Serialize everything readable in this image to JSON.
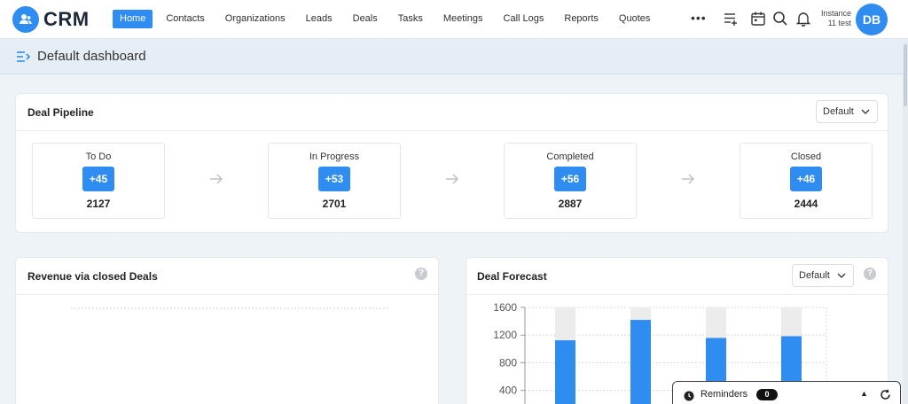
{
  "app": {
    "logo_text": "CRM"
  },
  "nav": {
    "items": [
      "Home",
      "Contacts",
      "Organizations",
      "Leads",
      "Deals",
      "Tasks",
      "Meetings",
      "Call Logs",
      "Reports",
      "Quotes"
    ],
    "active": "Home",
    "more": "•••"
  },
  "user": {
    "line1": "Instance",
    "line2": "11 test",
    "initials": "DB"
  },
  "page": {
    "title": "Default dashboard"
  },
  "pipeline": {
    "title": "Deal Pipeline",
    "dropdown": "Default",
    "stages": [
      {
        "name": "To Do",
        "delta": "+45",
        "count": "2127"
      },
      {
        "name": "In Progress",
        "delta": "+53",
        "count": "2701"
      },
      {
        "name": "Completed",
        "delta": "+56",
        "count": "2887"
      },
      {
        "name": "Closed",
        "delta": "+46",
        "count": "2444"
      }
    ]
  },
  "revenue": {
    "title": "Revenue via closed Deals",
    "help": "?"
  },
  "forecast": {
    "title": "Deal Forecast",
    "dropdown": "Default",
    "help": "?"
  },
  "chart_data": {
    "type": "bar",
    "title": "",
    "xlabel": "",
    "ylabel": "",
    "ylim": [
      0,
      1600
    ],
    "yticks": [
      400,
      800,
      1200,
      1600
    ],
    "grid": true,
    "series": [
      {
        "values": [
          1125,
          1420,
          1160,
          1185
        ],
        "color": "#2f8cf0"
      },
      {
        "values": [
          475,
          180,
          440,
          415
        ],
        "color": "#ececec"
      }
    ],
    "stacked": true
  },
  "reminders": {
    "label": "Reminders",
    "count": "0"
  },
  "colors": {
    "accent": "#2f8cf0",
    "track": "#ececec"
  }
}
